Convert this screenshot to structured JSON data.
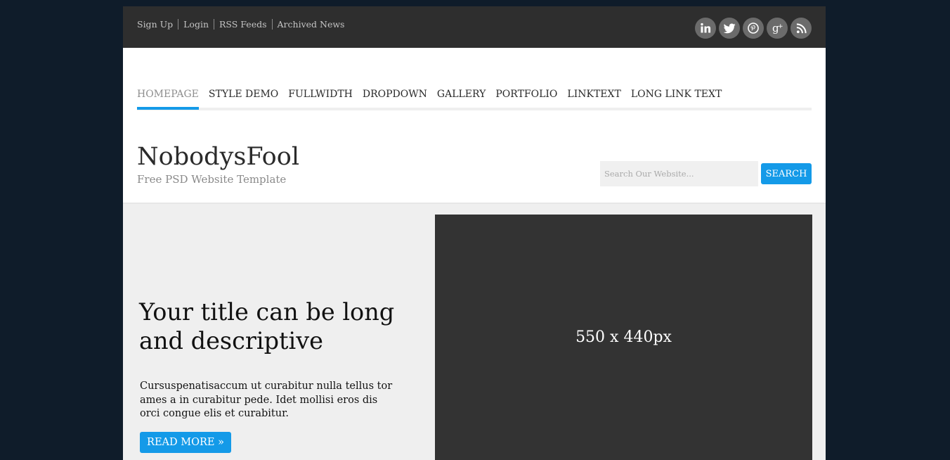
{
  "topbar": {
    "links": [
      "Sign Up",
      "Login",
      "RSS Feeds",
      "Archived News"
    ],
    "social_icons": [
      "linkedin-icon",
      "twitter-icon",
      "pinterest-icon",
      "google-plus-icon",
      "rss-icon"
    ]
  },
  "nav": {
    "items": [
      "HOMEPAGE",
      "STYLE DEMO",
      "FULLWIDTH",
      "DROPDOWN",
      "GALLERY",
      "PORTFOLIO",
      "LINKTEXT",
      "LONG LINK TEXT"
    ],
    "active_index": 0,
    "accent_color": "#149ae8"
  },
  "brand": {
    "title": "NobodysFool",
    "tagline": "Free PSD Website Template"
  },
  "search": {
    "placeholder": "Search Our Website...",
    "button_label": "SEARCH"
  },
  "hero": {
    "headline": "Your title can be long and descriptive",
    "body": "Cursuspenatisaccum ut curabitur nulla tellus tor ames a in curabitur pede. Idet mollisi eros dis orci congue elis et curabitur.",
    "button_label": "READ MORE »",
    "image_placeholder": "550 x 440px"
  },
  "colors": {
    "page_bg": "#0f1c2a",
    "topbar_bg": "#2e2e2e",
    "accent": "#149ae8",
    "hero_bg": "#efefef",
    "image_bg": "#333333"
  }
}
